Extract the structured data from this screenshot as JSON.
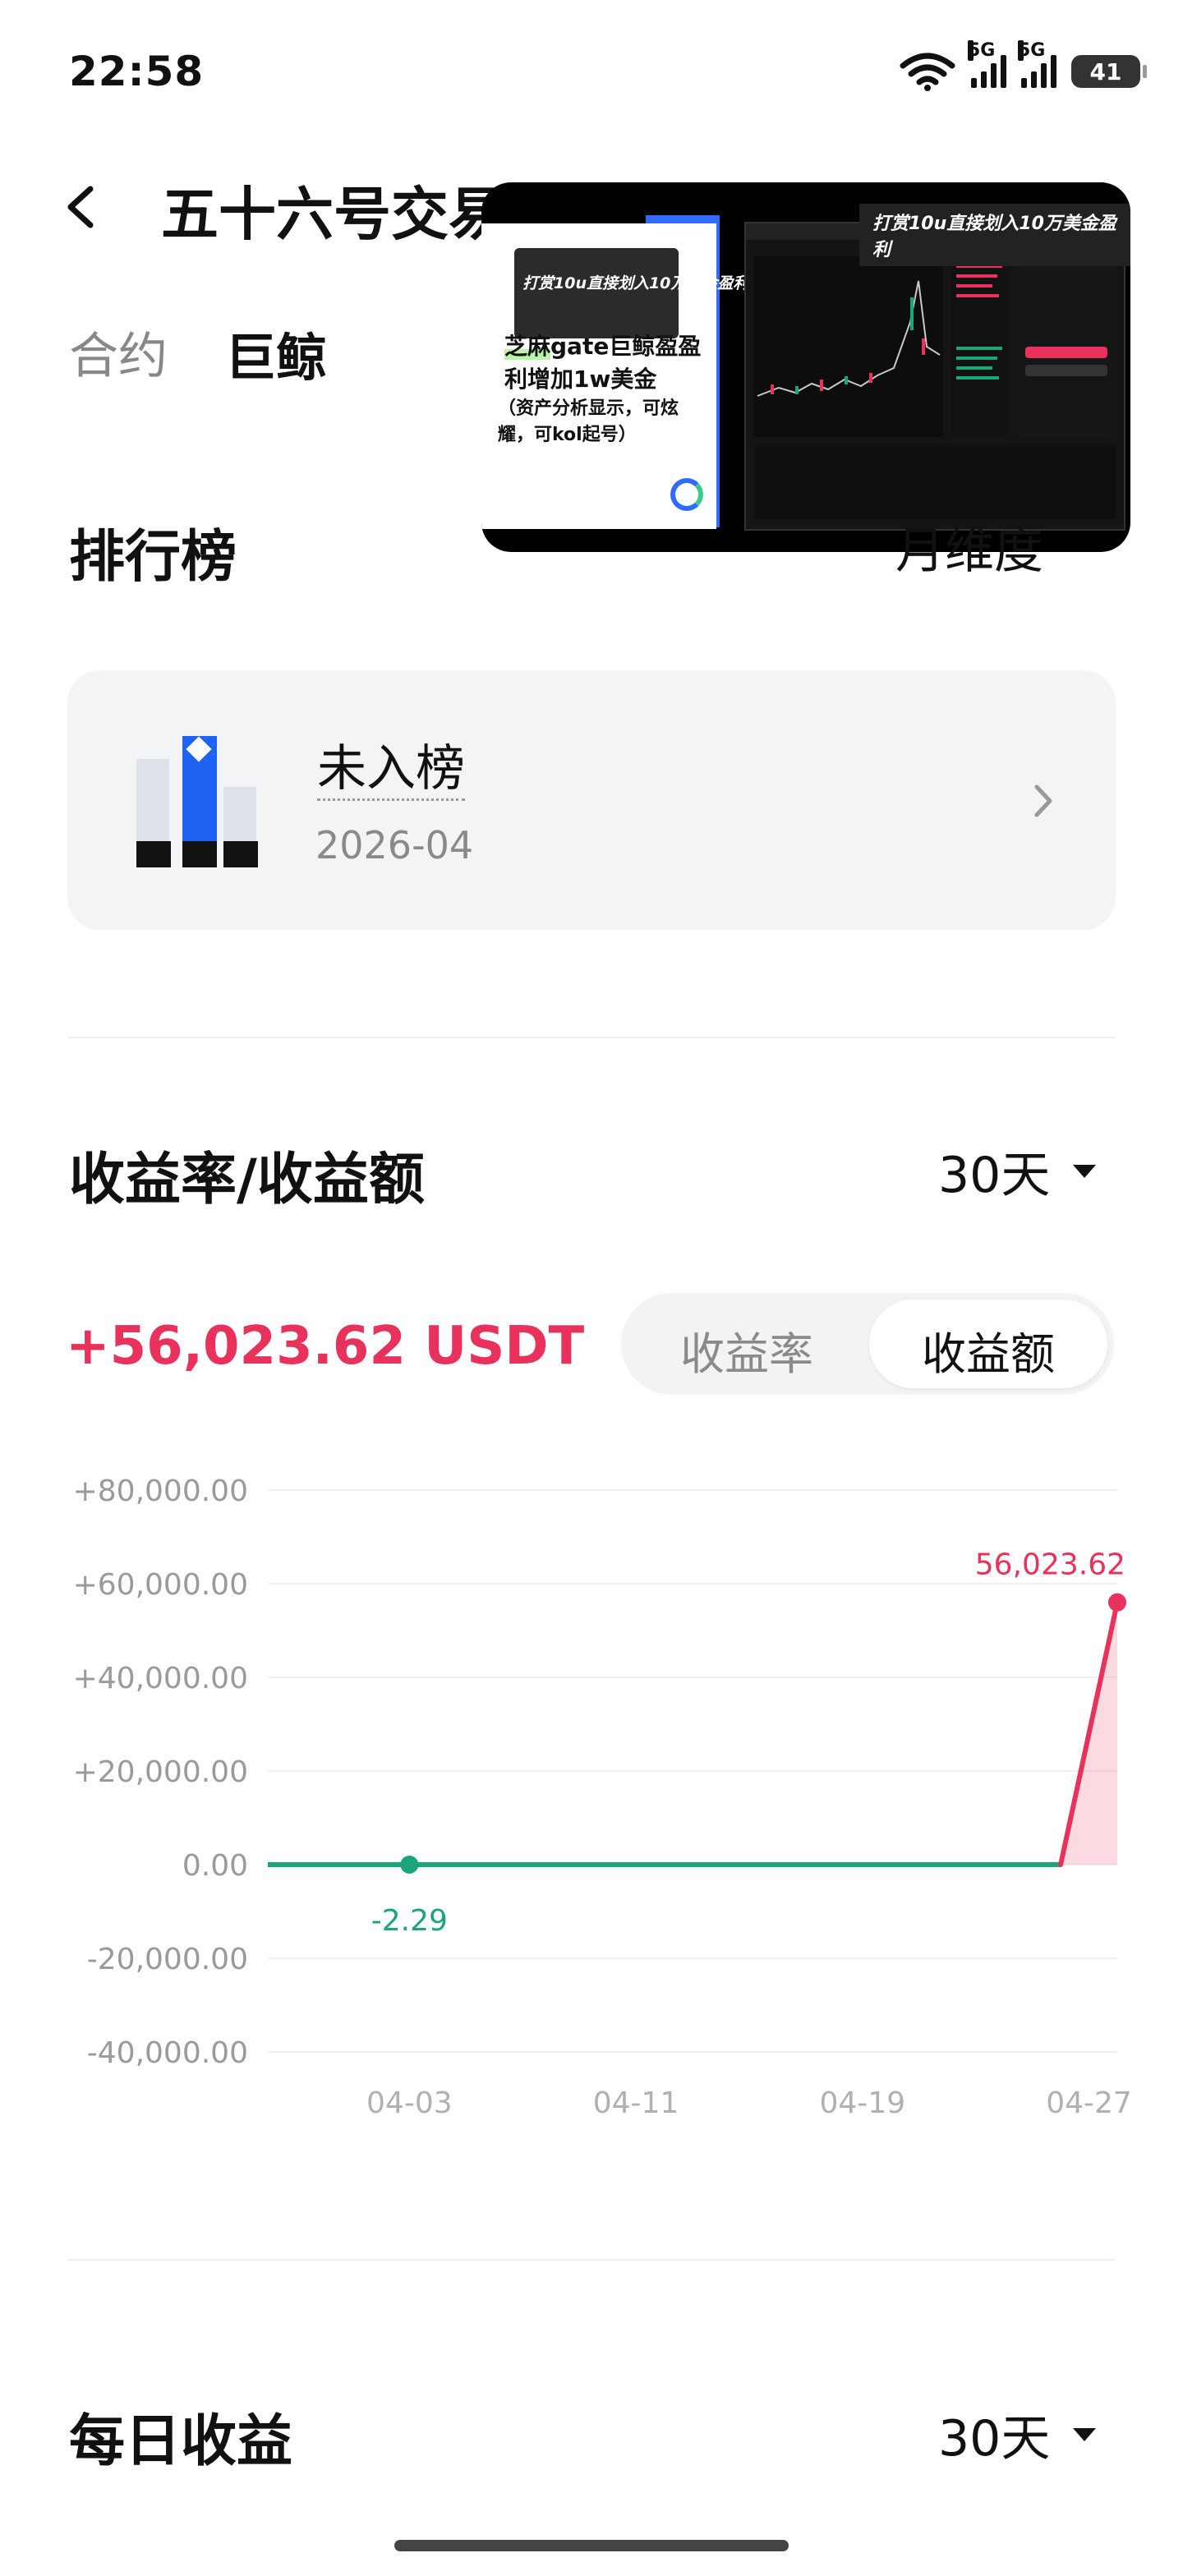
{
  "status_bar": {
    "time": "22:58",
    "signal1": "5G",
    "signal2": "5G",
    "battery": "41"
  },
  "header": {
    "title": "五十六号交易员",
    "tabs": [
      "合约",
      "巨鲸"
    ],
    "active_tab": "巨鲸"
  },
  "video_overlay": {
    "top_caption": "打赏10u直接划入10万美金盈利",
    "inner_caption": "打赏10u直接划入10万美金盈利",
    "headline_highlight": "芝麻",
    "headline_rest": "gate巨鲸盈盈利增加1w美金",
    "sub_caption": "（资产分析显示，可炫耀，可kol起号）"
  },
  "ranking": {
    "title": "排行榜",
    "period": "月维度",
    "status": "未入榜",
    "date": "2026-04"
  },
  "profit": {
    "title": "收益率/收益额",
    "range": "30天",
    "total": "+56,023.62 USDT",
    "toggle_rate": "收益率",
    "toggle_amount": "收益额",
    "active_toggle": "收益额"
  },
  "chart_data": {
    "type": "line",
    "y_ticks": [
      "+80,000.00",
      "+60,000.00",
      "+40,000.00",
      "+20,000.00",
      "0.00",
      "-20,000.00",
      "-40,000.00"
    ],
    "y_values": [
      80000,
      60000,
      40000,
      20000,
      0,
      -20000,
      -40000
    ],
    "ylim": [
      -40000,
      80000
    ],
    "x_ticks": [
      "04-03",
      "04-11",
      "04-19",
      "04-27"
    ],
    "x_tick_days": [
      3,
      11,
      19,
      27
    ],
    "xlim": [
      -2,
      28
    ],
    "series": [
      {
        "x": [
          -2,
          3,
          26,
          28
        ],
        "y": [
          0,
          -2.29,
          0,
          56023.62
        ]
      }
    ],
    "annotations": [
      {
        "x": 3,
        "y": -2.29,
        "label": "-2.29",
        "color": "#1aa67a"
      },
      {
        "x": 28,
        "y": 56023.62,
        "label": "56,023.62",
        "color": "#e8315b"
      }
    ],
    "colors": {
      "positive": "#e8315b",
      "negative": "#1aa67a",
      "grid": "#f0f0f0"
    }
  },
  "daily": {
    "title": "每日收益",
    "range": "30天"
  }
}
